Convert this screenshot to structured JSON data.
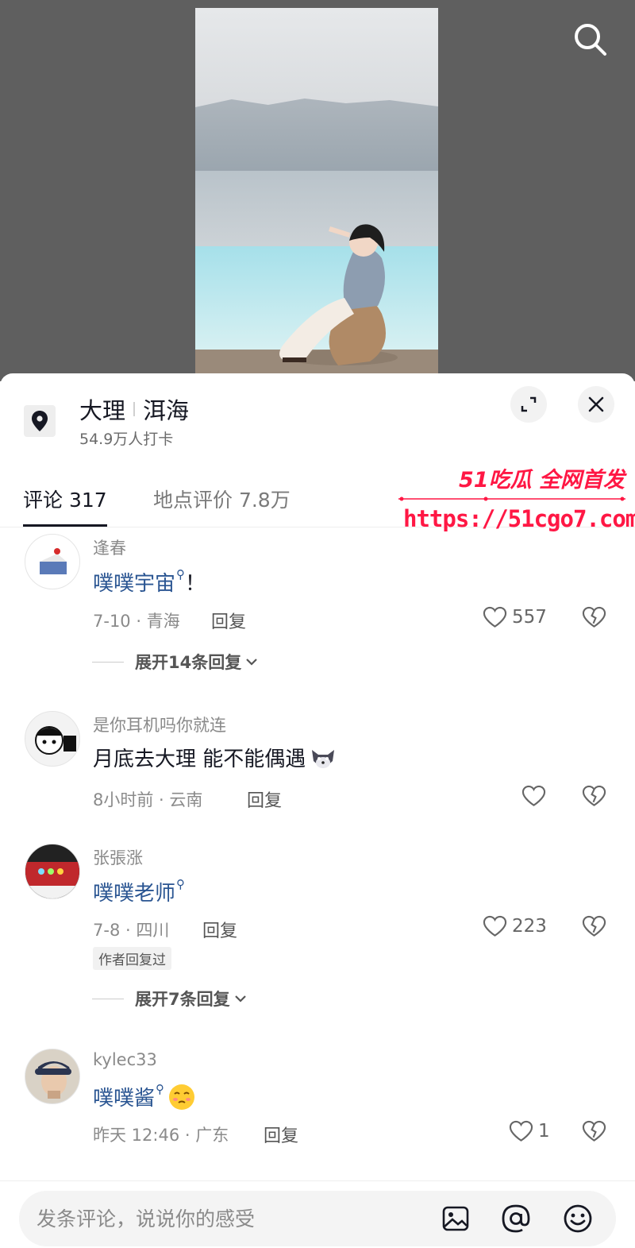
{
  "location": {
    "city": "大理",
    "place": "洱海",
    "checkins": "54.9万人打卡"
  },
  "tabs": [
    {
      "label": "评论 317"
    },
    {
      "label": "地点评价 7.8万"
    }
  ],
  "watermark": {
    "top_text": "51吃瓜 全网首发",
    "url": "https://51cgo7.com"
  },
  "comments": [
    {
      "user": "逢春",
      "link_text": "噗噗宇宙",
      "tail": "！",
      "meta": "7-10 · 青海",
      "reply": "回复",
      "likes": "557",
      "expand": "展开14条回复"
    },
    {
      "user": "是你耳机吗你就连",
      "text": "月底去大理 能不能偶遇",
      "meta": "8小时前 · 云南",
      "reply": "回复",
      "likes": ""
    },
    {
      "user": "张張涨",
      "link_text": "噗噗老师",
      "meta": "7-8 · 四川",
      "reply": "回复",
      "likes": "223",
      "badge": "作者回复过",
      "expand": "展开7条回复"
    },
    {
      "user": "kylec33",
      "link_text": "噗噗酱",
      "meta": "昨天 12:46 · 广东",
      "reply": "回复",
      "likes": "1"
    }
  ],
  "input": {
    "placeholder": "发条评论，说说你的感受"
  },
  "icons": {
    "search": "search-icon",
    "pin": "location-pin-icon",
    "expand": "expand-icon",
    "close": "close-icon",
    "heart": "heart-icon",
    "broken_heart": "broken-heart-icon",
    "image": "image-icon",
    "at": "at-icon",
    "emoji": "emoji-icon"
  },
  "colors": {
    "link": "#2a5592",
    "watermark": "#ff1744",
    "text": "#161823"
  }
}
